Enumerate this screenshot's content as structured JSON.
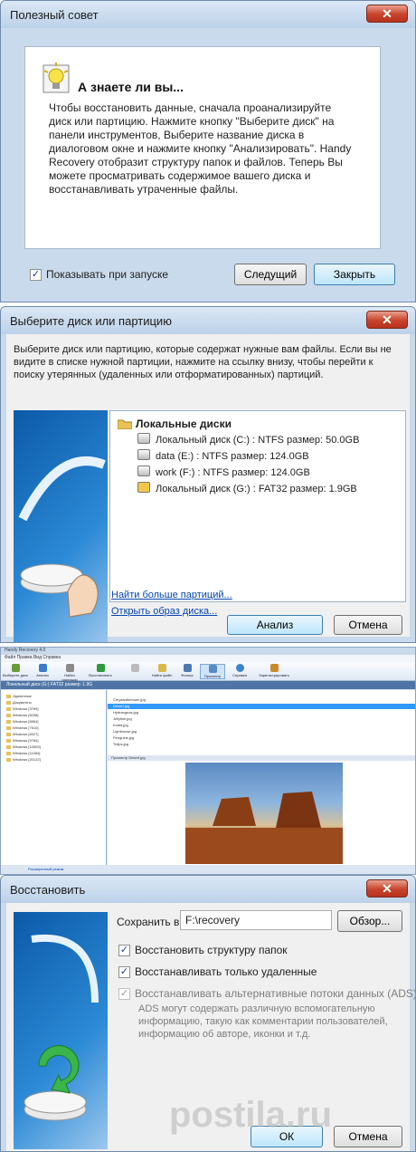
{
  "tip_dialog": {
    "title": "Полезный совет",
    "heading": "А знаете ли вы...",
    "body": "Чтобы восстановить данные, сначала проанализируйте диск или партицию. Нажмите кнопку \"Выберите диск\" на панели инструментов, Выберите название диска в диалоговом окне и нажмите кнопку \"Анализировать\". Handy Recovery отобразит структуру папок и файлов. Теперь Вы можете просматривать содержимое вашего диска и восстанавливать утраченные файлы.",
    "show_on_start_label": "Показывать при запуске",
    "show_on_start_checked": true,
    "next_label": "Следущий",
    "close_label": "Закрыть"
  },
  "disk_dialog": {
    "title": "Выберите диск или партицию",
    "description": "Выберите диск или партицию, которые содержат нужные вам файлы. Если вы не видите в списке нужной партиции, нажмите на ссылку внизу, чтобы перейти к поиску утерянных (удаленных или отформатированных) партиций.",
    "group_label": "Локальные диски",
    "disks": [
      "Локальный диск (C:) : NTFS размер: 50.0GB",
      "data (E:) : NTFS размер: 124.0GB",
      "work (F:) : NTFS размер: 124.0GB",
      "Локальный диск (G:) : FAT32 размер: 1.9GB"
    ],
    "find_more_link": "Найти больше партиций...",
    "open_image_link": "Открыть образ диска...",
    "analyze_label": "Анализ",
    "cancel_label": "Отмена"
  },
  "main_window": {
    "title": "Handy Recovery 4.0",
    "menu": "Файл   Правка   Вид   Справка",
    "toolbar": [
      "Выберите диск",
      "Анализ",
      "Найти партиции",
      "Восстановить",
      "",
      "Найти файл",
      "Фильтр",
      "Просмотр",
      "Справка",
      "Зарегистрировать"
    ],
    "path": "Локальный диск (G:) FAT32 размер: 1.9G",
    "tree": [
      "Удаленные",
      "Документы",
      "Windows [3769]",
      "Windows [6038]",
      "Windows [6564]",
      "Windows [7510]",
      "Windows [8327]",
      "Windows [9784]",
      "Windows [10509]",
      "Windows [11084]",
      "Windows [20122]"
    ],
    "files": [
      {
        "name": "Chrysanthemum.jpg",
        "selected": false
      },
      {
        "name": "Desert.jpg",
        "selected": true
      },
      {
        "name": "Hydrangeas.jpg",
        "selected": false
      },
      {
        "name": "Jellyfish.jpg",
        "selected": false
      },
      {
        "name": "Koala.jpg",
        "selected": false
      },
      {
        "name": "Lighthouse.jpg",
        "selected": false
      },
      {
        "name": "Penguins.jpg",
        "selected": false
      },
      {
        "name": "Tulips.jpg",
        "selected": false
      }
    ],
    "preview_label": "Просмотр Desert.jpg",
    "status_link": "Расширенный режим"
  },
  "restore_dialog": {
    "title": "Восстановить",
    "save_to_label": "Сохранить в:",
    "save_to_value": "F:\\recovery",
    "browse_label": "Обзор...",
    "option_structure": "Восстановить структуру папок",
    "option_structure_checked": true,
    "option_deleted_only": "Восстанавливать только удаленные",
    "option_deleted_checked": true,
    "option_ads": "Восстанавливать альтернативные потоки данных (ADS)",
    "option_ads_checked": true,
    "ads_note": "ADS могут содержать различную вспомогательную информацию, такую как комментарии пользователей, информацию об авторе, иконки и т.д.",
    "ok_label": "ОК",
    "cancel_label": "Отмена"
  },
  "watermark": "postila.ru"
}
